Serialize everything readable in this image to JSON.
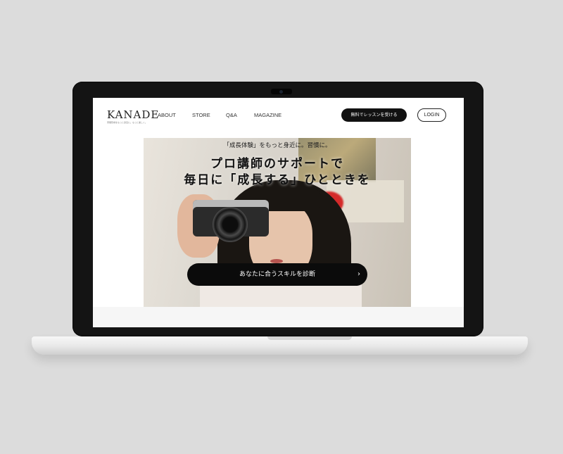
{
  "site": {
    "logo": "KANADE",
    "tagline": "習慣形成をもっと身近に。もっと楽しく。"
  },
  "nav": {
    "items": [
      {
        "label": "ABOUT"
      },
      {
        "label": "STORE"
      },
      {
        "label": "Q&A"
      },
      {
        "label": "MAGAZINE"
      }
    ]
  },
  "header": {
    "cta_label": "無料でレッスンを受ける",
    "login_label": "LOGIN"
  },
  "hero": {
    "small_text": "「成長体験」をもっと身近に。習慣に。",
    "title_line1": "プロ講師のサポートで",
    "title_line2": "毎日に「成長する」ひとときを",
    "button_label": "あなたに合うスキルを診断",
    "button_icon": "chevron-right-icon"
  },
  "colors": {
    "background": "#dcdcdc",
    "accent": "#111111",
    "button_text": "#ffffff"
  }
}
